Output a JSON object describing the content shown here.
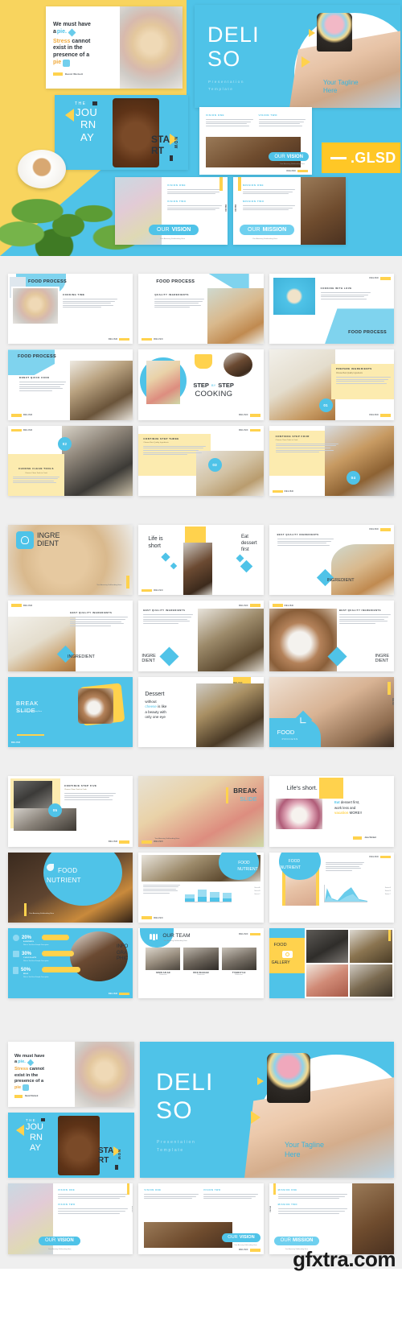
{
  "meta": {
    "brand": "DELISO",
    "watermark": "gfxtra.com",
    "logo_suffix": ".GLSD"
  },
  "colors": {
    "blue": "#4FC3E8",
    "blue_dark": "#3FA9CC",
    "yellow": "#FFD24D",
    "yellow_deep": "#F8D45E",
    "ink": "#2d3339",
    "page_bg": "#efefef"
  },
  "hero": {
    "title_line1": "DELI",
    "title_line2": "SO",
    "subtitle_line1": "Presentation",
    "subtitle_line2": "Template",
    "tagline_line1": "Your Tagline",
    "tagline_line2": "Here"
  },
  "quote_slide": {
    "line1": "We must have",
    "line2_a": "a ",
    "line2_b": "pie.",
    "line3_a": "Stress",
    "line3_b": " cannot",
    "line4": "exist in the",
    "line5": "presence of a",
    "line6": "pie",
    "author": "David Wickett"
  },
  "journey_slide": {
    "the": "THE",
    "word_a": "JOU",
    "word_b": "RN",
    "word_c": "AY",
    "start_a": "STA",
    "start_b": "RT",
    "now": "NOW"
  },
  "vision_slide": {
    "col1_title": "VISION ONE",
    "col2_title": "VISION TWO",
    "badge_a": "OUR",
    "badge_b": "VISION",
    "badge_sub": "Your Amazing Subheading Here"
  },
  "mission_slide": {
    "col1_title": "MISSION ONE",
    "col2_title": "MISSION TWO",
    "badge_a": "OUR",
    "badge_b": "MISSION",
    "badge_sub": "Your Amazing Subheading Here"
  },
  "sections": [
    {
      "id": "food-process",
      "slides": [
        {
          "name": "food-process-cooking-time",
          "title": "FOOD PROCESS",
          "sub": "COOKING TIME",
          "badge": "DELISO"
        },
        {
          "name": "food-process-quality-ingredients",
          "title": "FOOD PROCESS",
          "sub": "QUALITY INGREDIENTS",
          "badge": "DELISO"
        },
        {
          "name": "food-process-cooking-with-love",
          "title": "FOOD PROCESS",
          "sub": "COOKING WITH LOVE",
          "badge": "DELISO"
        },
        {
          "name": "food-process-donut-quick-cook",
          "title": "FOOD PROCESS",
          "sub": "DONUT QUICK COOK",
          "badge": "DELISO"
        },
        {
          "name": "step-by-step-cooking",
          "title_a": "STEP",
          "title_mid": "BY",
          "title_b": "STEP",
          "title_c": "COOKING",
          "badge": "DELISO"
        },
        {
          "name": "prepare-ingredients",
          "title": "PREPARE INGREDIENTS",
          "sub": "Choose Best Quality Ingredients",
          "number": "01",
          "badge": "DELISO"
        },
        {
          "name": "choose-clean-tools",
          "title": "CHOOSE CLEAN TOOLS",
          "sub": "Choose Clean Tools to Cook",
          "number": "02",
          "badge": "DELISO"
        },
        {
          "name": "continue-step-three",
          "title": "CONTINUE STEP THREE",
          "sub": "Choose Best Quality Ingredients",
          "number": "03",
          "badge": "DELISO"
        },
        {
          "name": "continue-step-four",
          "title": "CONTINUE STEP FOUR",
          "sub": "Choose Clean Tools to Cook",
          "number": "04",
          "badge": "DELISO"
        }
      ]
    },
    {
      "id": "ingredient",
      "slides": [
        {
          "name": "ingredient-cover",
          "title_a": "INGRE",
          "title_b": "DIENT",
          "sub": "Your Amazing Subheading Here",
          "badge": "DELISO"
        },
        {
          "name": "life-is-short",
          "line_a": "Life is",
          "line_b": "short",
          "line_c": "Eat",
          "line_d": "dessert",
          "line_e": "first",
          "badge": "DELISO"
        },
        {
          "name": "ingredient-best-quality-1",
          "title": "INGREDIENT",
          "sub": "BEST QUALITY INGREDIENTS",
          "badge": "DELISO"
        },
        {
          "name": "ingredient-best-quality-2",
          "title": "INGREDIENT",
          "sub": "BEST QUALITY INGREDIENTS",
          "badge": "DELISO"
        },
        {
          "name": "ingredient-best-quality-3",
          "title_a": "INGRE",
          "title_b": "DIENT",
          "sub": "BEST QUALITY INGREDIENTS",
          "badge": "DELISO"
        },
        {
          "name": "ingredient-best-quality-4",
          "title_a": "INGRE",
          "title_b": "DIENT",
          "sub": "BEST QUALITY INGREDIENTS",
          "badge": "DELISO"
        },
        {
          "name": "break-slide-ingredient",
          "title_a": "BREAK",
          "title_b": "SLIDE",
          "sub": "Your Amazing Subheading Here",
          "badge": "DELISO"
        },
        {
          "name": "dessert-quote",
          "line1": "Dessert",
          "line2": "without",
          "line3_a": "cheese",
          "line3_b": " is like",
          "line4": "a beauty with",
          "line5": "only one eye",
          "badge": "DELISO"
        },
        {
          "name": "food-process-cover",
          "title": "FOOD",
          "sub": "PROCESS",
          "badge": "DELISO"
        }
      ]
    },
    {
      "id": "nutrient",
      "slides": [
        {
          "name": "continue-step-five",
          "title": "CONTINUE STEP FIVE",
          "sub": "Choose Clean Tools to Cook",
          "number": "05",
          "badge": "DELISO"
        },
        {
          "name": "break-slide-macaron",
          "title_a": "BREAK",
          "title_b": "SLIDE",
          "sub": "Your Amazing Subheading Here",
          "badge": "DELISO"
        },
        {
          "name": "lifes-short",
          "headline": "Life's short.",
          "line_a": "Eat",
          "line_b": " dessert first,",
          "line_c": "work less and",
          "line_d": "vacation",
          "line_e": " MORE!!",
          "author": "Jane Wickett",
          "badge": "DELISO"
        },
        {
          "name": "food-nutrient-cover",
          "title_a": "FOOD",
          "title_b": "NUTRIENT",
          "sub": "Your Amazing Subheading Here",
          "badge": "DELISO"
        },
        {
          "name": "food-nutrient-bar-chart",
          "title_a": "FOOD",
          "title_b": "NUTRIENT",
          "badge": "DELISO"
        },
        {
          "name": "food-nutrient-area-chart",
          "title_a": "FOOD",
          "title_b": "NUTRIENT",
          "badge": "DELISO"
        },
        {
          "name": "infographic",
          "title_a": "INFO",
          "title_b": "GRA",
          "title_c": "PHIC",
          "badge": "DELISO"
        },
        {
          "name": "our-team",
          "title": "OUR TEAM",
          "sub": "Your Amazing Subheading Here",
          "badge": "DELISO"
        },
        {
          "name": "food-gallery",
          "title_a": "FOOD",
          "title_b": "GALLERY",
          "badge": "DELISO"
        }
      ]
    }
  ],
  "chart_data": [
    {
      "type": "bar",
      "name": "food-nutrient-bar-chart",
      "title": "FOOD NUTRIENT",
      "categories": [
        "CATEGORY 1",
        "CATEGORY 2",
        "CATEGORY 3",
        "CATEGORY 4"
      ],
      "series": [
        {
          "name": "Series A",
          "values": [
            42,
            70,
            55,
            48
          ],
          "color": "#4FC3E8"
        },
        {
          "name": "Series B",
          "values": [
            26,
            34,
            30,
            28
          ],
          "color": "#9CDDF2"
        }
      ],
      "legend": [
        "Series A",
        "Series B",
        "Series C"
      ],
      "legend_position": "right",
      "ylim": [
        0,
        100
      ],
      "grid": false
    },
    {
      "type": "area",
      "name": "food-nutrient-area-chart",
      "title": "FOOD NUTRIENT",
      "x": [
        0,
        1,
        2,
        3,
        4,
        5,
        6
      ],
      "series": [
        {
          "name": "Series A",
          "values": [
            10,
            62,
            18,
            8,
            40,
            55,
            12
          ],
          "color": "#4FC3E8"
        },
        {
          "name": "Series B",
          "values": [
            6,
            28,
            10,
            5,
            20,
            30,
            8
          ],
          "color": "#9CDDF2"
        }
      ],
      "legend": [
        "Series A",
        "Series B",
        "Series C"
      ],
      "legend_position": "right",
      "ylim": [
        0,
        70
      ],
      "grid": true
    },
    {
      "type": "bar",
      "name": "infographic-percentages",
      "title": "INFO GRA PHIC",
      "orientation": "horizontal",
      "categories": [
        "ALMONDS",
        "CHOCOLATE",
        "MILK"
      ],
      "values": [
        20,
        30,
        50
      ],
      "value_labels": [
        "20%",
        "30%",
        "50%"
      ],
      "descriptions": [
        "Write a Text Here Sample Description",
        "Write a Text Here Sample Description",
        "Write a Text Here Sample Description"
      ],
      "ylim": [
        0,
        100
      ],
      "grid": false
    }
  ],
  "team": {
    "title": "OUR TEAM",
    "sub": "Your Amazing Subheading Here",
    "members": [
      {
        "name": "KEVIN AZLAN",
        "role": "Webmaster"
      },
      {
        "name": "RICO SIAHAAN",
        "role": "Webmaster"
      },
      {
        "name": "TYSON KYLE",
        "role": "Webmaster"
      }
    ]
  },
  "gallery": {
    "title_a": "FOOD",
    "title_b": "GALLERY",
    "icon": "camera-icon"
  }
}
